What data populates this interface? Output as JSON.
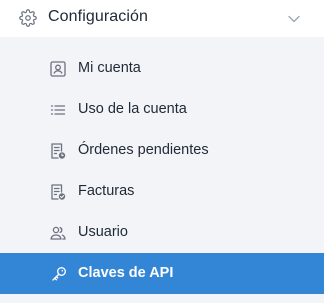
{
  "header": {
    "title": "Configuración",
    "icon": "gear-icon",
    "toggle_icon": "chevron-down-icon"
  },
  "menu": {
    "items": [
      {
        "label": "Mi cuenta",
        "icon": "id-card-icon",
        "active": false
      },
      {
        "label": "Uso de la cuenta",
        "icon": "list-icon",
        "active": false
      },
      {
        "label": "Órdenes pendientes",
        "icon": "document-clock-icon",
        "active": false
      },
      {
        "label": "Facturas",
        "icon": "document-check-icon",
        "active": false
      },
      {
        "label": "Usuario",
        "icon": "users-icon",
        "active": false
      },
      {
        "label": "Claves de API",
        "icon": "key-icon",
        "active": true
      }
    ]
  },
  "colors": {
    "active_background": "#3385d6",
    "menu_background": "#f3f4f7",
    "header_background": "#ffffff",
    "text": "#1f2937",
    "icon": "#6b7280"
  }
}
